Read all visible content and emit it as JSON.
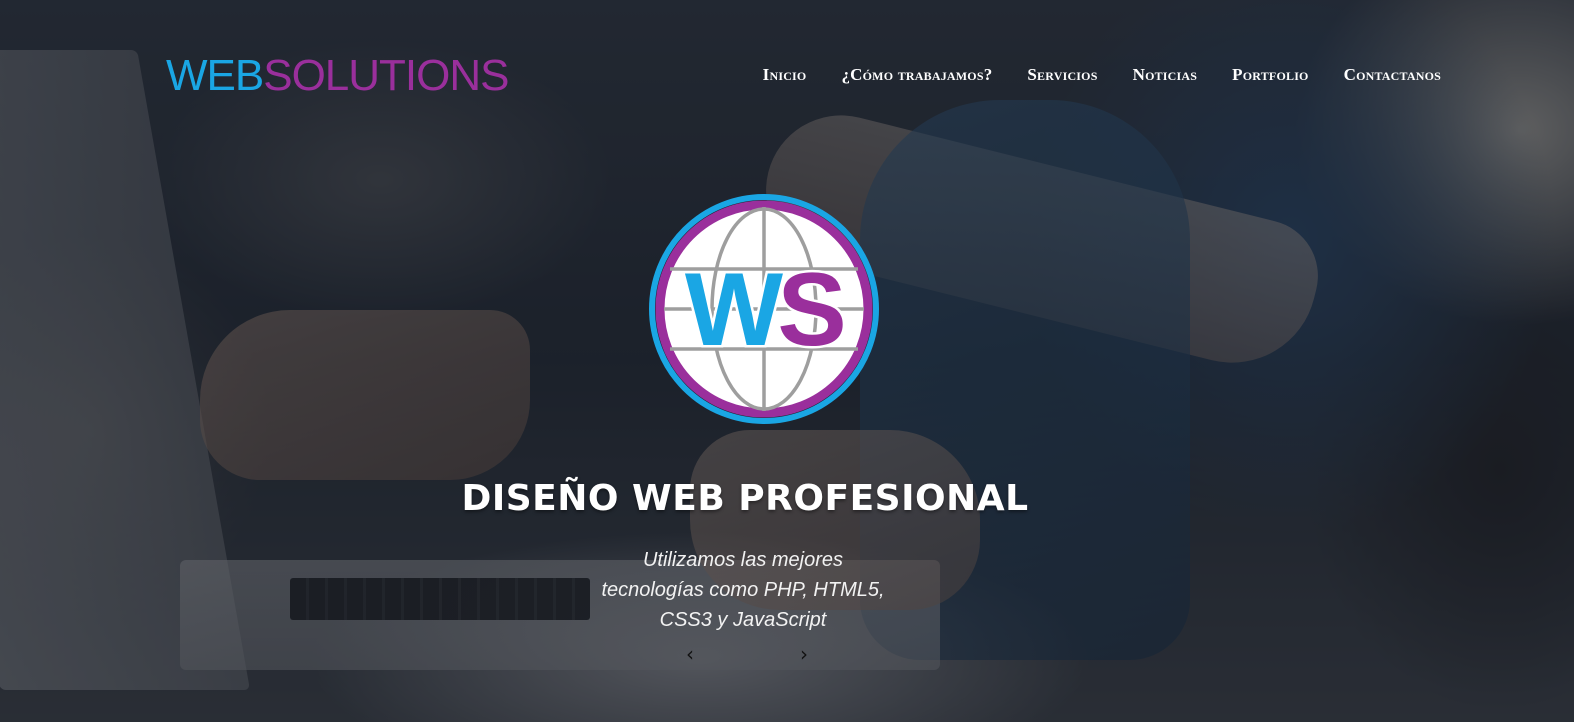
{
  "brand": {
    "part1": "WEB",
    "part2": "SOLUTIONS",
    "colors": {
      "primary": "#1aa6e4",
      "secondary": "#9a2f9c"
    }
  },
  "nav": {
    "items": [
      {
        "label": "Inicio"
      },
      {
        "label": "¿Cómo trabajamos?"
      },
      {
        "label": "Servicios"
      },
      {
        "label": "Noticias"
      },
      {
        "label": "Portfolio"
      },
      {
        "label": "Contactanos"
      }
    ]
  },
  "hero": {
    "emblem_text": "WS",
    "title": "DISEÑO WEB PROFESIONAL",
    "subtitle_lines": [
      "Utilizamos las mejores",
      "tecnologías como PHP, HTML5,",
      "CSS3 y JavaScript"
    ],
    "prev_icon": "‹",
    "next_icon": "›"
  }
}
